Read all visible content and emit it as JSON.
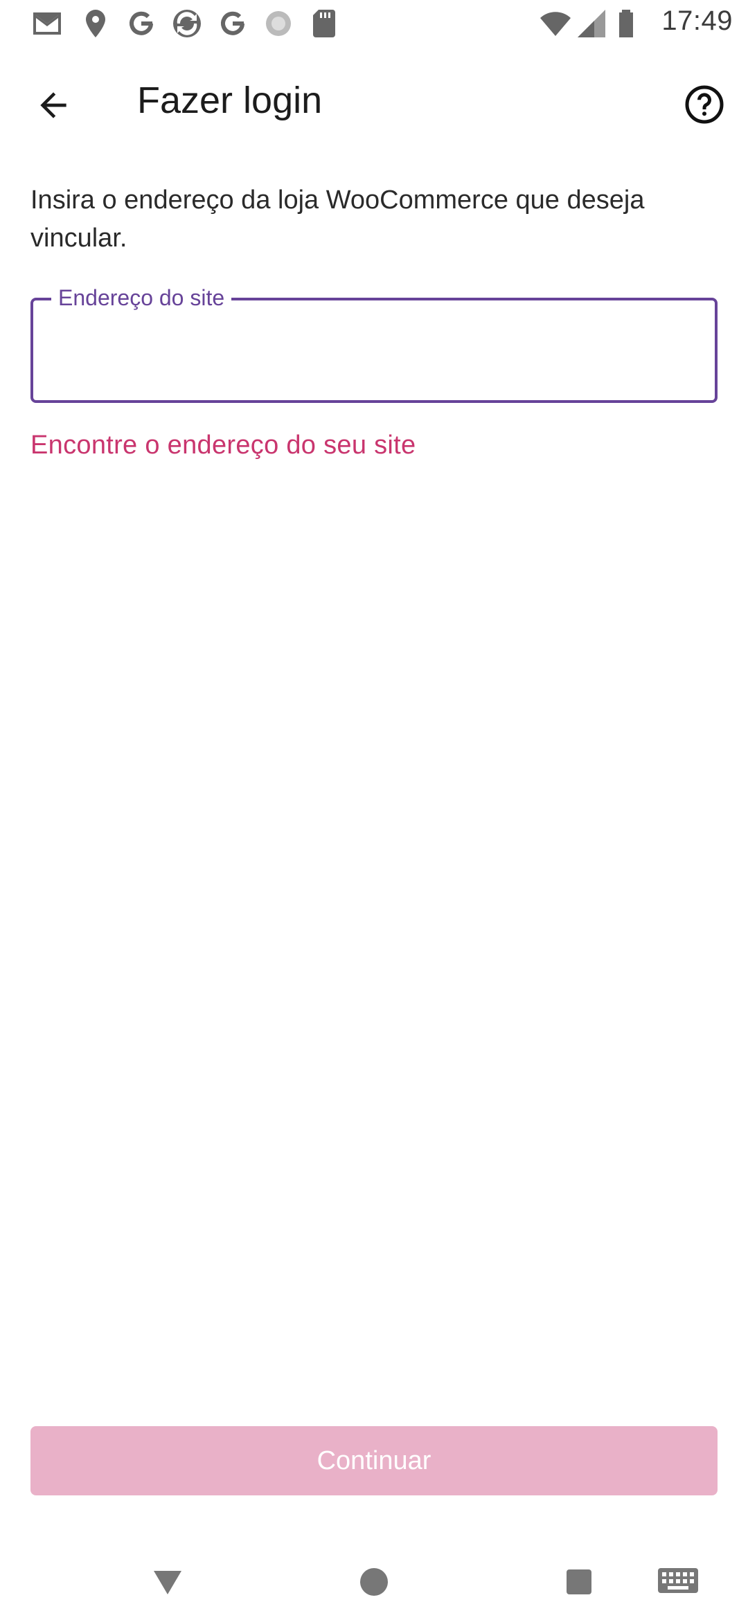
{
  "status_bar": {
    "time": "17:49",
    "icons": [
      "gmail-icon",
      "location-icon",
      "google-icon",
      "sync-app-icon",
      "google-icon",
      "loading-icon",
      "sd-card-icon",
      "wifi-icon",
      "cellular-signal-icon",
      "battery-icon"
    ]
  },
  "app_bar": {
    "title": "Fazer login"
  },
  "main": {
    "instruction": "Insira o endereço da loja WooCommerce que deseja vincular.",
    "site_field": {
      "label": "Endereço do site",
      "value": ""
    },
    "find_link": "Encontre o endereço do seu site"
  },
  "footer": {
    "continue_label": "Continuar"
  },
  "colors": {
    "accent_purple": "#674399",
    "link_pink": "#c9356e",
    "button_disabled": "#e9b1c8"
  }
}
